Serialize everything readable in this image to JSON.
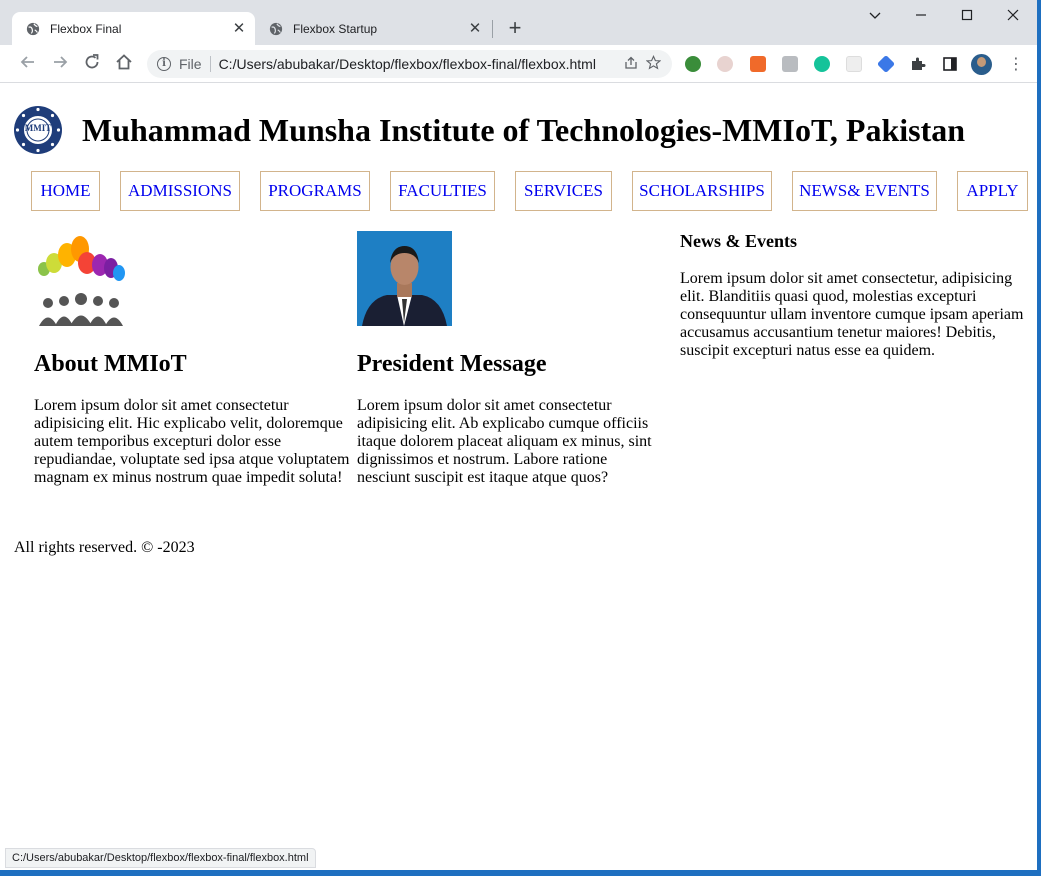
{
  "browser": {
    "tabs": [
      {
        "title": "Flexbox Final",
        "active": true
      },
      {
        "title": "Flexbox Startup",
        "active": false
      }
    ],
    "new_tab": "+",
    "omnibox": {
      "scheme_label": "File",
      "url": "C:/Users/abubakar/Desktop/flexbox/flexbox-final/flexbox.html"
    },
    "status_text": "C:/Users/abubakar/Desktop/flexbox/flexbox-final/flexbox.html"
  },
  "page": {
    "logo_text": "MMIT",
    "title": "Muhammad Munsha Institute of Technologies-MMIoT, Pakistan",
    "nav": [
      "HOME",
      "ADMISSIONS",
      "PROGRAMS",
      "FACULTIES",
      "SERVICES",
      "SCHOLARSHIPS",
      "NEWS& EVENTS",
      "APPLY"
    ],
    "about": {
      "heading": "About MMIoT",
      "text": "Lorem ipsum dolor sit amet consectetur adipisicing elit. Hic explicabo velit, doloremque autem temporibus excepturi dolor esse repudiandae, voluptate sed ipsa atque voluptatem magnam ex minus nostrum quae impedit soluta!"
    },
    "president": {
      "heading": "President Message",
      "text": "Lorem ipsum dolor sit amet consectetur adipisicing elit. Ab explicabo cumque officiis itaque dolorem placeat aliquam ex minus, sint dignissimos et nostrum. Labore ratione nesciunt suscipit est itaque atque quos?"
    },
    "news": {
      "heading": "News & Events",
      "text": "Lorem ipsum dolor sit amet consectetur, adipisicing elit. Blanditiis quasi quod, molestias excepturi consequuntur ullam inventore cumque ipsam aperiam accusamus accusantium tenetur maiores! Debitis, suscipit excepturi natus esse ea quidem."
    },
    "footer": "All rights reserved. © -2023"
  },
  "colors": {
    "link": "#0000ee",
    "nav_border": "#d2b48c",
    "tabstrip": "#dee1e6",
    "window_border": "#1e6fc0"
  }
}
